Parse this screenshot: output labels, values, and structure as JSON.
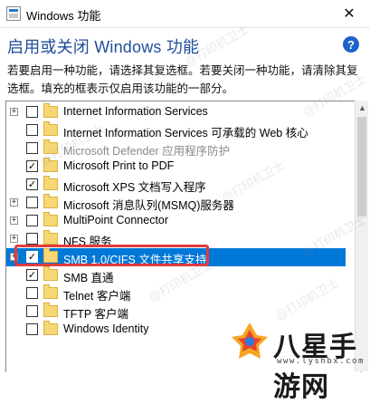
{
  "window": {
    "title": "Windows 功能",
    "close_glyph": "✕"
  },
  "heading": "启用或关闭 Windows 功能",
  "help_glyph": "?",
  "description": "若要启用一种功能，请选择其复选框。若要关闭一种功能，请清除其复选框。填充的框表示仅启用该功能的一部分。",
  "features": [
    {
      "label": "Internet Information Services",
      "expander": "+",
      "check": "",
      "disabled": false
    },
    {
      "label": "Internet Information Services 可承载的 Web 核心",
      "expander": "",
      "check": "",
      "disabled": false
    },
    {
      "label": "Microsoft Defender 应用程序防护",
      "expander": "",
      "check": "",
      "disabled": true
    },
    {
      "label": "Microsoft Print to PDF",
      "expander": "",
      "check": "✓",
      "disabled": false
    },
    {
      "label": "Microsoft XPS 文档写入程序",
      "expander": "",
      "check": "✓",
      "disabled": false
    },
    {
      "label": "Microsoft 消息队列(MSMQ)服务器",
      "expander": "+",
      "check": "",
      "disabled": false
    },
    {
      "label": "MultiPoint Connector",
      "expander": "+",
      "check": "",
      "disabled": false
    },
    {
      "label": "NFS 服务",
      "expander": "+",
      "check": "",
      "disabled": false
    },
    {
      "label": "SMB 1.0/CIFS 文件共享支持",
      "expander": "+",
      "check": "✓",
      "disabled": false,
      "selected": true
    },
    {
      "label": "SMB 直通",
      "expander": "",
      "check": "✓",
      "disabled": false
    },
    {
      "label": "Telnet 客户端",
      "expander": "",
      "check": "",
      "disabled": false
    },
    {
      "label": "TFTP 客户端",
      "expander": "",
      "check": "",
      "disabled": false
    },
    {
      "label": "Windows Identity",
      "expander": "",
      "check": "",
      "disabled": false
    }
  ],
  "scrollbar": {
    "up_glyph": "▲"
  },
  "watermark_text": "@打印机卫士",
  "logo": {
    "text": "八星手游网",
    "sub": "www.lyshbx.com"
  },
  "colors": {
    "selection": "#0078d7",
    "highlight_border": "#e03c3c",
    "heading": "#1f4e9b"
  }
}
